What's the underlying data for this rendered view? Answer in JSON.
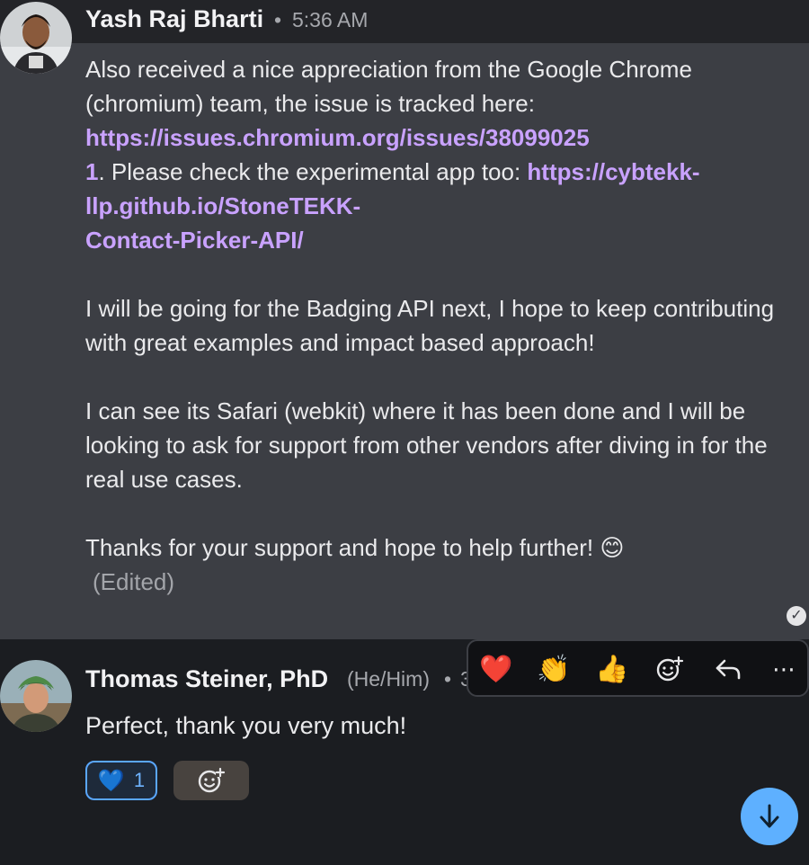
{
  "message1": {
    "author": "Yash Raj Bharti",
    "separator": "•",
    "time": "5:36 AM",
    "para1_pre": "Also received a nice appreciation from the Google Chrome (chromium) team, the issue is tracked here: ",
    "link1_line1": "https://issues.chromium.org/issues/38099025",
    "link1_line2": "1",
    "para1_mid": ". Please check the experimental app too: ",
    "link2_line1": "https://cybtekk-llp.github.io/StoneTEKK-",
    "link2_line2": "Contact-Picker-API/",
    "para2": "I will be going for the Badging API next, I hope to keep contributing with great examples and impact based approach!",
    "para3": "I can see its Safari (webkit) where it has been done and I will be looking to ask for support from other vendors after diving in for the real use cases.",
    "para4": "Thanks for your support and hope to help further! 😊",
    "edited": "(Edited)",
    "read_check": "✓"
  },
  "message2": {
    "author": "Thomas Steiner, PhD",
    "pronouns": "(He/Him)",
    "separator": "•",
    "time_partial": "3",
    "body": "Perfect, thank you very much!",
    "reaction": {
      "emoji": "💙",
      "count": "1"
    }
  },
  "toolbar": {
    "heart": "❤️",
    "clap": "👏",
    "thumbs": "👍",
    "more": "⋯"
  },
  "icons": [
    "add-reaction-icon",
    "reply-icon",
    "more-icon",
    "arrow-down-icon"
  ],
  "colors": {
    "link": "#c9a2ff",
    "accent": "#5eb0ff",
    "message_bg": "#3c3e44"
  }
}
